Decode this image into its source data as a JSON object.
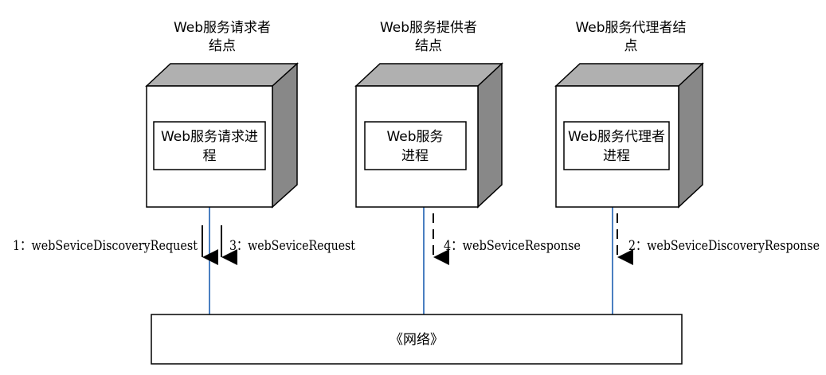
{
  "nodes": {
    "requester": {
      "title_line1": "Web服务请求者",
      "title_line2": "结点",
      "process_line1": "Web服务请求进",
      "process_line2": "程"
    },
    "provider": {
      "title_line1": "Web服务提供者",
      "title_line2": "结点",
      "process_line1": "Web服务",
      "process_line2": "进程"
    },
    "broker": {
      "title_line1": "Web服务代理者结",
      "title_line2": "点",
      "process_line1": "Web服务代理者",
      "process_line2": "进程"
    }
  },
  "messages": {
    "m1": "1：webSeviceDiscoveryRequest",
    "m2": "2：webSeviceDiscoveryResponse",
    "m3": "3：webSeviceRequest",
    "m4": "4：webSeviceResponse"
  },
  "network": {
    "label": "《网络》"
  },
  "colors": {
    "cube_front": "#ffffff",
    "cube_top": "#b0b0b0",
    "cube_side": "#888888",
    "connector": "#4a7fc1",
    "stroke": "#000000"
  }
}
